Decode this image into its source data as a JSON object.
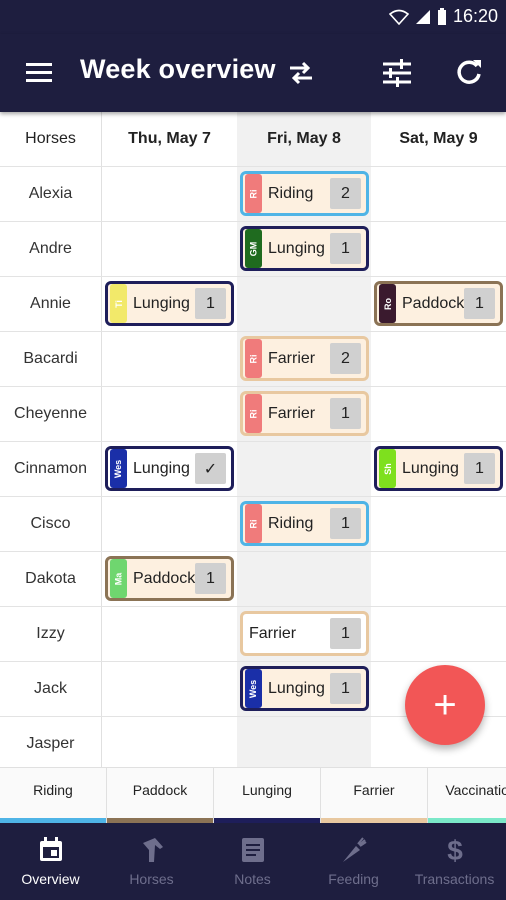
{
  "status_bar": {
    "time": "16:20",
    "icons": [
      "wifi-icon",
      "signal-icon",
      "battery-icon"
    ]
  },
  "app_bar": {
    "title": "Week overview",
    "icons": [
      "menu-icon",
      "swap-icon",
      "tune-icon",
      "refresh-icon"
    ]
  },
  "grid": {
    "horses_header": "Horses",
    "days": [
      {
        "label": "Thu, May 7"
      },
      {
        "label": "Fri, May 8"
      },
      {
        "label": "Sat, May 9"
      }
    ],
    "horses": [
      "Alexia",
      "Andre",
      "Annie",
      "Bacardi",
      "Cheyenne",
      "Cinnamon",
      "Cisco",
      "Dakota",
      "Izzy",
      "Jack",
      "Jasper"
    ],
    "tasks": [
      {
        "horse": "Alexia",
        "day": "Fri, May 8",
        "tag": "Ri",
        "name": "Riding",
        "count": "2",
        "tag_color": "#f07b7b",
        "border_color": "#4fb4e6",
        "bg": "#fdf0e0"
      },
      {
        "horse": "Andre",
        "day": "Fri, May 8",
        "tag": "GM",
        "name": "Lunging",
        "count": "1",
        "tag_color": "#1f6b1f",
        "border_color": "#1e1e5a",
        "bg": "#fdf0e0"
      },
      {
        "horse": "Annie",
        "day": "Thu, May 7",
        "tag": "Ti",
        "name": "Lunging",
        "count": "1",
        "tag_color": "#f2e96a",
        "border_color": "#1e1e5a",
        "bg": "#fdf0e0"
      },
      {
        "horse": "Annie",
        "day": "Sat, May 9",
        "tag": "Ro",
        "name": "Paddock",
        "count": "1",
        "tag_color": "#3a1a2e",
        "border_color": "#8b7355",
        "bg": "#fdf0e0"
      },
      {
        "horse": "Bacardi",
        "day": "Fri, May 8",
        "tag": "Ri",
        "name": "Farrier",
        "count": "2",
        "tag_color": "#f07b7b",
        "border_color": "#e8c8a0",
        "bg": "#fdf0e0"
      },
      {
        "horse": "Cheyenne",
        "day": "Fri, May 8",
        "tag": "Ri",
        "name": "Farrier",
        "count": "1",
        "tag_color": "#f07b7b",
        "border_color": "#e8c8a0",
        "bg": "#fdf0e0"
      },
      {
        "horse": "Cinnamon",
        "day": "Thu, May 7",
        "tag": "Wes",
        "name": "Lunging",
        "count": "✓",
        "tag_color": "#1a2fa8",
        "border_color": "#1e1e5a",
        "bg": "#ffffff"
      },
      {
        "horse": "Cinnamon",
        "day": "Sat, May 9",
        "tag": "Sh",
        "name": "Lunging",
        "count": "1",
        "tag_color": "#7ee01e",
        "border_color": "#1e1e5a",
        "bg": "#fdf0e0"
      },
      {
        "horse": "Cisco",
        "day": "Fri, May 8",
        "tag": "Ri",
        "name": "Riding",
        "count": "1",
        "tag_color": "#f07b7b",
        "border_color": "#4fb4e6",
        "bg": "#fdf0e0"
      },
      {
        "horse": "Dakota",
        "day": "Thu, May 7",
        "tag": "Ma",
        "name": "Paddock",
        "count": "1",
        "tag_color": "#6fd66f",
        "border_color": "#8b7355",
        "bg": "#fdf0e0"
      },
      {
        "horse": "Izzy",
        "day": "Fri, May 8",
        "tag": "",
        "name": "Farrier",
        "count": "1",
        "tag_color": "",
        "border_color": "#e8c8a0",
        "bg": "#ffffff"
      },
      {
        "horse": "Jack",
        "day": "Fri, May 8",
        "tag": "Wes",
        "name": "Lunging",
        "count": "1",
        "tag_color": "#1a2fa8",
        "border_color": "#1e1e5a",
        "bg": "#fdf0e0"
      }
    ]
  },
  "fab": {
    "label": "+"
  },
  "legend": [
    {
      "label": "Riding",
      "color": "#4fb4e6"
    },
    {
      "label": "Paddock",
      "color": "#8b7355"
    },
    {
      "label": "Lunging",
      "color": "#1e1e5a"
    },
    {
      "label": "Farrier",
      "color": "#e8c8a0"
    },
    {
      "label": "Vaccination",
      "color": "#7be8c8"
    }
  ],
  "bottom_nav": [
    {
      "label": "Overview",
      "icon": "calendar-icon",
      "active": true
    },
    {
      "label": "Horses",
      "icon": "horse-icon",
      "active": false
    },
    {
      "label": "Notes",
      "icon": "notes-icon",
      "active": false
    },
    {
      "label": "Feeding",
      "icon": "carrot-icon",
      "active": false
    },
    {
      "label": "Transactions",
      "icon": "dollar-icon",
      "active": false
    }
  ],
  "colors": {
    "primary": "#1e1e3f",
    "fab": "#f25656",
    "highlight_column": "#f1f1f1"
  }
}
